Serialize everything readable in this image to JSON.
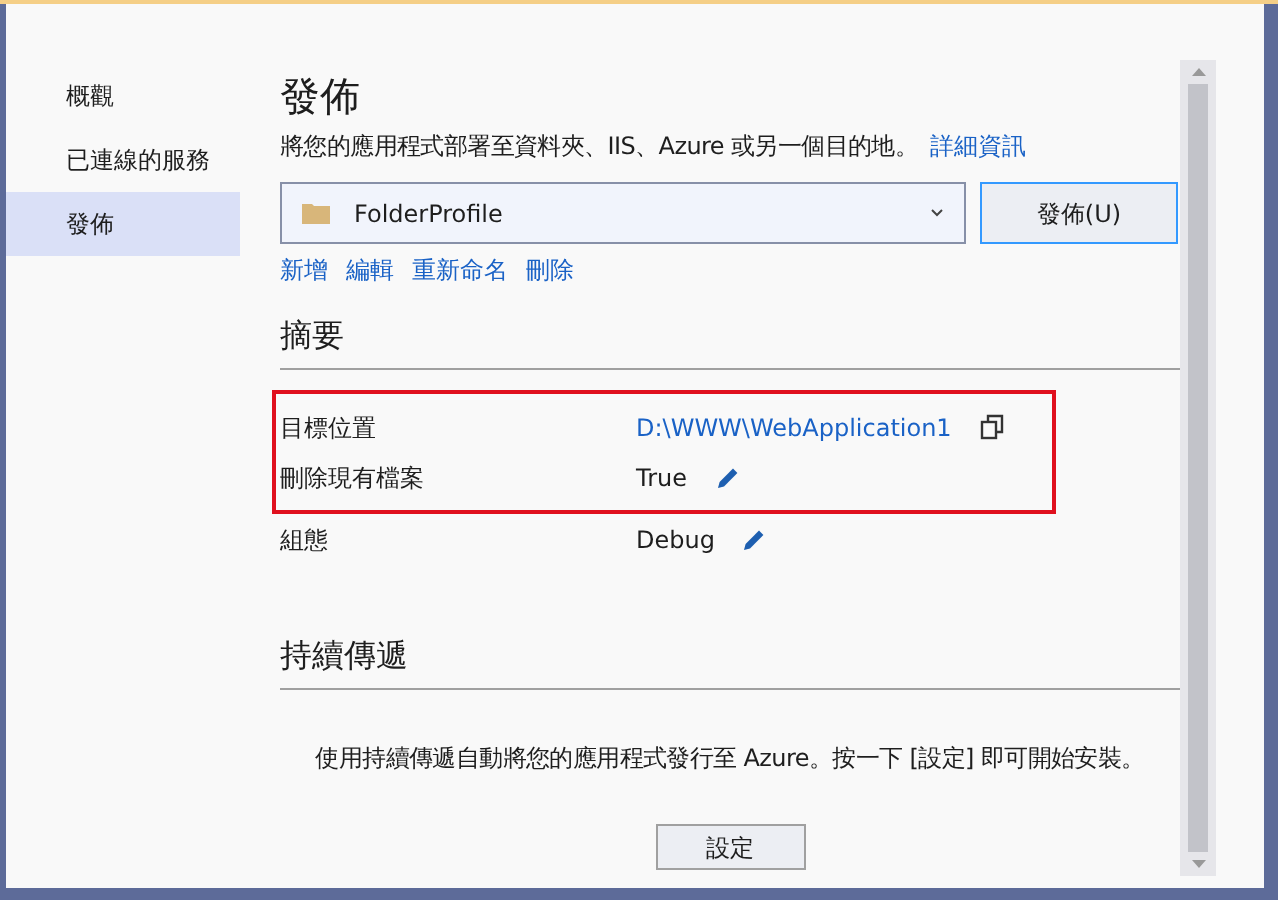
{
  "sidebar": {
    "items": [
      {
        "label": "概觀",
        "selected": false
      },
      {
        "label": "已連線的服務",
        "selected": false
      },
      {
        "label": "發佈",
        "selected": true
      }
    ]
  },
  "title": "發佈",
  "description": "將您的應用程式部署至資料夾、IIS、Azure 或另一個目的地。",
  "more_link": "詳細資訊",
  "profile": {
    "value": "FolderProfile"
  },
  "publish_button": "發佈(U)",
  "profile_actions": [
    "新增",
    "編輯",
    "重新命名",
    "刪除"
  ],
  "summary": {
    "heading": "摘要",
    "rows": [
      {
        "label": "目標位置",
        "value": "D:\\WWW\\WebApplication1",
        "kind": "copyable",
        "highlighted": true
      },
      {
        "label": "刪除現有檔案",
        "value": "True",
        "kind": "editable",
        "highlighted": true
      },
      {
        "label": "組態",
        "value": "Debug",
        "kind": "editable",
        "highlighted": false
      }
    ]
  },
  "continuous": {
    "heading": "持續傳遞",
    "text": "使用持續傳遞自動將您的應用程式發行至 Azure。按一下 [設定] 即可開始安裝。",
    "button": "設定"
  }
}
